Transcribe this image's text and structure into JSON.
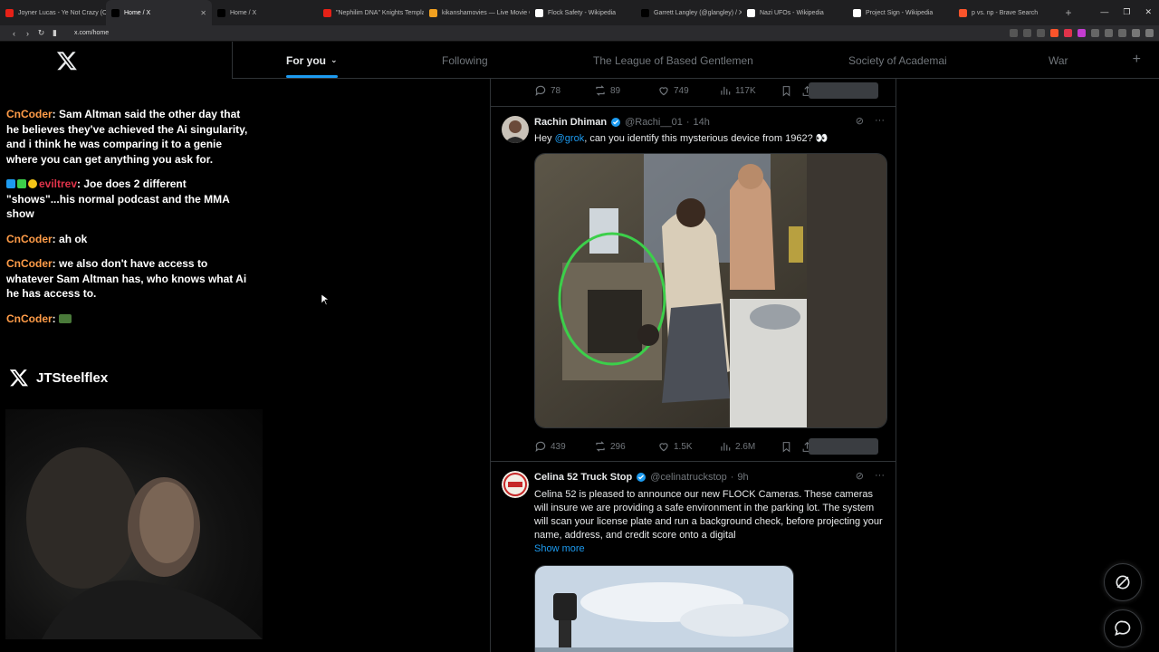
{
  "browser": {
    "tabs": [
      {
        "title": "Joyner Lucas - Ye Not Crazy (Offic",
        "favicon_color": "#e62117",
        "active": false
      },
      {
        "title": "Home / X",
        "favicon_color": "#000000",
        "active": true
      },
      {
        "title": "Home / X",
        "favicon_color": "#000000",
        "active": false
      },
      {
        "title": "\"Nephilim DNA\" Knights Templar",
        "favicon_color": "#e62117",
        "active": false
      },
      {
        "title": "kikanshamovies — Live Movie Ch",
        "favicon_color": "#f0a020",
        "active": false
      },
      {
        "title": "Flock Safety - Wikipedia",
        "favicon_color": "#ffffff",
        "active": false
      },
      {
        "title": "Garrett Langley (@glangley) / X",
        "favicon_color": "#000000",
        "active": false
      },
      {
        "title": "Nazi UFOs - Wikipedia",
        "favicon_color": "#ffffff",
        "active": false
      },
      {
        "title": "Project Sign - Wikipedia",
        "favicon_color": "#ffffff",
        "active": false
      },
      {
        "title": "p vs. np - Brave Search",
        "favicon_color": "#fb542b",
        "active": false
      }
    ],
    "url": "x.com/home"
  },
  "topnav": {
    "tabs": [
      "For you",
      "Following",
      "The League of Based Gentlemen",
      "Society of Academai",
      "War"
    ]
  },
  "chat": {
    "messages": [
      {
        "user": "CnCoder",
        "text": "Sam Altman said the other day that he believes they've achieved the Ai singularity, and i think he was comparing it to a genie where you can get anything you ask for.",
        "user_color": "#ff9c48",
        "badges": false
      },
      {
        "user": "eviltrev",
        "text": "Joe does 2 different \"shows\"...his normal podcast and the MMA show",
        "user_color": "#e0334a",
        "badges": true
      },
      {
        "user": "CnCoder",
        "text": "ah ok",
        "user_color": "#ff9c48",
        "badges": false
      },
      {
        "user": "CnCoder",
        "text": "we also don't have access to whatever Sam Altman has, who knows what Ai he has access to.",
        "user_color": "#ff9c48",
        "badges": false
      },
      {
        "user": "CnCoder",
        "text": "",
        "user_color": "#ff9c48",
        "badges": false,
        "emote": true
      }
    ]
  },
  "streamer": {
    "name": "JTSteelflex"
  },
  "feed": {
    "top_actions": {
      "replies": "78",
      "reposts": "89",
      "likes": "749",
      "views": "117K"
    },
    "tweets": [
      {
        "display_name": "Rachin Dhiman",
        "handle": "@Rachi__01",
        "time": "14h",
        "text_pre": "Hey ",
        "mention": "@grok",
        "text_post": ", can you identify this mysterious device from 1962? 👀",
        "actions": {
          "replies": "439",
          "reposts": "296",
          "likes": "1.5K",
          "views": "2.6M"
        }
      },
      {
        "display_name": "Celina 52 Truck Stop",
        "handle": "@celinatruckstop",
        "time": "9h",
        "text": "Celina 52 is pleased to announce our new FLOCK Cameras. These cameras will insure we are providing a safe environment in the parking lot. The system will scan your license plate and run a background check, before projecting your name, address, and credit score onto a digital",
        "show_more": "Show more"
      }
    ]
  },
  "colors": {
    "accent": "#1d9bf0",
    "background": "#000000",
    "border": "#2f3336",
    "muted": "#71767b"
  }
}
